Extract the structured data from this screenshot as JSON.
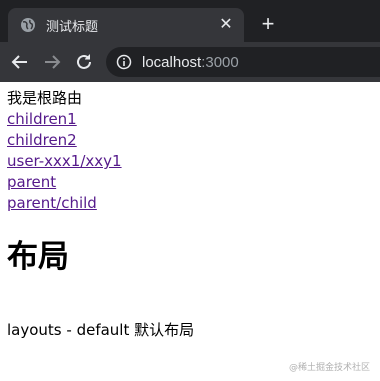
{
  "browser": {
    "tab_title": "测试标题",
    "tab_close": "✕",
    "new_tab": "+",
    "url_host": "localhost",
    "url_port": ":3000"
  },
  "page": {
    "root_text": "我是根路由",
    "links": [
      "children1",
      "children2",
      "user-xxx1/xxy1",
      "parent",
      "parent/child"
    ],
    "heading": "布局",
    "layout_text": "layouts - default 默认布局"
  },
  "watermark": "@稀土掘金技术社区",
  "colors": {
    "tab_bar_bg": "#202124",
    "toolbar_bg": "#35363a",
    "visited_link": "#551a8b"
  },
  "icons": {
    "favicon": "globe-icon",
    "back": "back-arrow-icon",
    "forward": "forward-arrow-icon",
    "reload": "reload-icon",
    "site_info": "info-icon"
  }
}
